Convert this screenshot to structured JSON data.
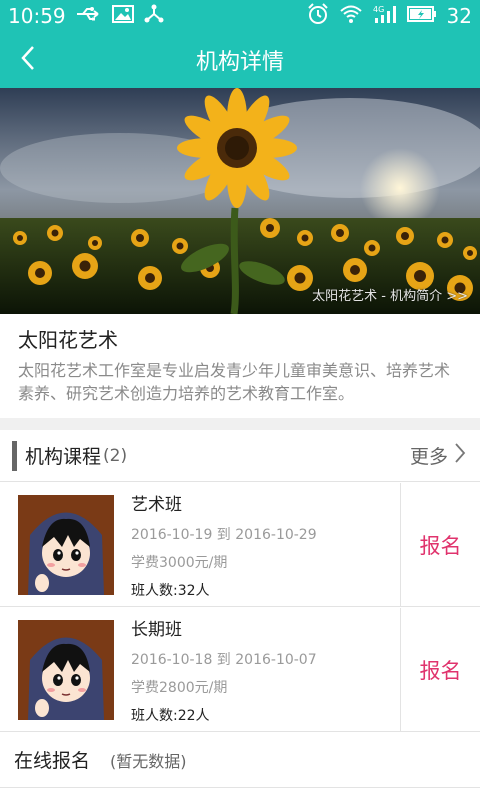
{
  "status_bar": {
    "time": "10:59",
    "battery": "32",
    "network": "4G"
  },
  "header": {
    "title": "机构详情"
  },
  "banner": {
    "caption": "太阳花艺术 - 机构简介 >>"
  },
  "org": {
    "name": "太阳花艺术",
    "description": "太阳花艺术工作室是专业启发青少年儿童审美意识、培养艺术素养、研究艺术创造力培养的艺术教育工作室。"
  },
  "courses_section": {
    "title": "机构课程",
    "count": "(2)",
    "more_label": "更多",
    "items": [
      {
        "name": "艺术班",
        "dates": "2016-10-19 到 2016-10-29",
        "fee": "学费3000元/期",
        "size": "班人数:32人",
        "action": "报名"
      },
      {
        "name": "长期班",
        "dates": "2016-10-18 到 2016-10-07",
        "fee": "学费2800元/期",
        "size": "班人数:22人",
        "action": "报名"
      }
    ]
  },
  "online_section": {
    "title": "在线报名",
    "empty": "(暂无数据)"
  },
  "colors": {
    "primary": "#1fc3b5",
    "accent": "#e0336d"
  }
}
